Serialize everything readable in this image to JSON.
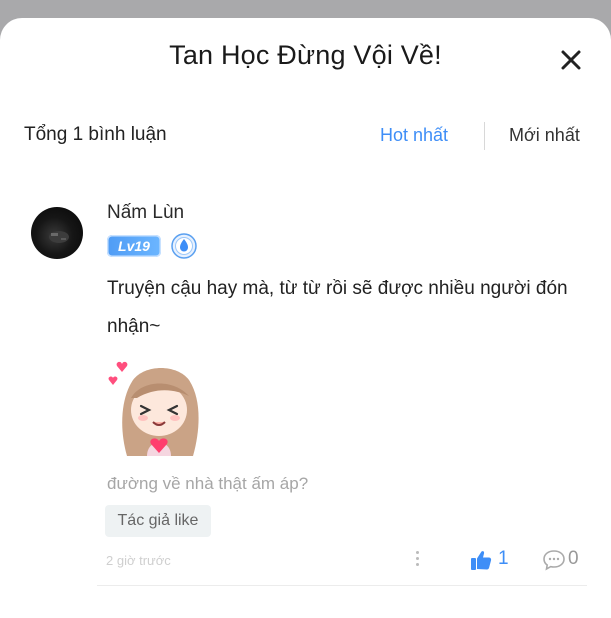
{
  "dialog": {
    "title": "Tan Học Đừng Vội Về!",
    "close_icon": "close-icon"
  },
  "comments_header": {
    "total_label": "Tổng 1 bình luận",
    "tabs": [
      {
        "label": "Hot nhất",
        "active": true
      },
      {
        "label": "Mới nhất",
        "active": false
      }
    ],
    "accent_color": "#3e8ef7"
  },
  "comment": {
    "username": "Nấm Lùn",
    "level_badge": "Lv19",
    "rank_icon": "water-drop-badge-icon",
    "text": "Truyện cậu hay mà, từ từ rồi sẽ được nhiều người đón nhận~",
    "sticker": "anime-girl-heart-sticker",
    "sticker_caption": "đường về nhà thật ấm áp?",
    "tag": "Tác giả like",
    "timestamp": "2 giờ trước",
    "more_icon": "more-vertical-icon",
    "like_icon": "thumbs-up-icon",
    "likes": "1",
    "reply_icon": "comment-bubble-icon",
    "replies": "0"
  }
}
